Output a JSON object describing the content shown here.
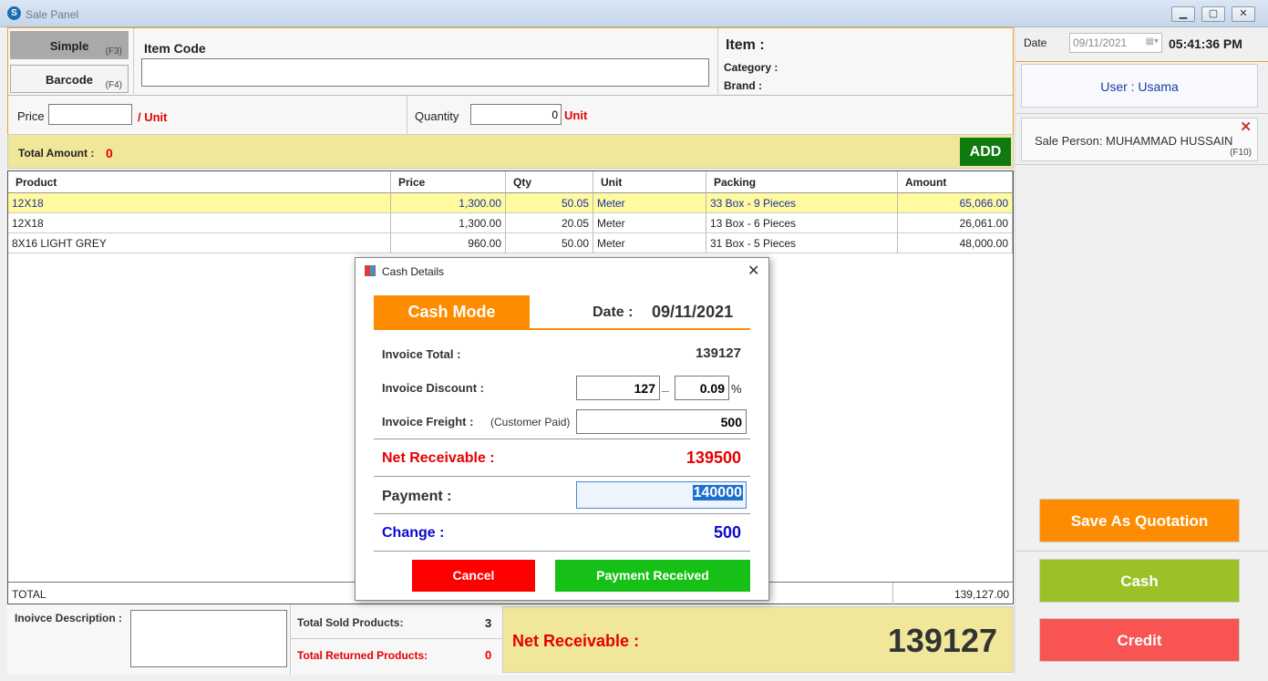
{
  "window": {
    "title": "Sale Panel",
    "app_icon": "S"
  },
  "mode": {
    "simple_label": "Simple",
    "simple_key": "(F3)",
    "barcode_label": "Barcode",
    "barcode_key": "(F4)"
  },
  "item_code": {
    "label": "Item Code",
    "value": ""
  },
  "item_info": {
    "item_label": "Item :",
    "category_label": "Category :",
    "brand_label": "Brand :"
  },
  "price": {
    "label": "Price",
    "value": "",
    "unit": "/ Unit"
  },
  "quantity": {
    "label": "Quantity",
    "value": "0",
    "unit": "Unit"
  },
  "total_amount": {
    "label": "Total Amount :",
    "value": "0"
  },
  "add_label": "ADD",
  "table": {
    "headers": [
      "Product",
      "Price",
      "Qty",
      "Unit",
      "Packing",
      "Amount"
    ],
    "rows": [
      {
        "product": "12X18",
        "price": "1,300.00",
        "qty": "50.05",
        "unit": "Meter",
        "packing": "33 Box - 9 Pieces",
        "amount": "65,066.00"
      },
      {
        "product": "12X18",
        "price": "1,300.00",
        "qty": "20.05",
        "unit": "Meter",
        "packing": "13 Box - 6 Pieces",
        "amount": "26,061.00"
      },
      {
        "product": "8X16 LIGHT GREY",
        "price": "960.00",
        "qty": "50.00",
        "unit": "Meter",
        "packing": "31 Box - 5 Pieces",
        "amount": "48,000.00"
      }
    ],
    "total_label": "TOTAL",
    "total_value": "139,127.00"
  },
  "sidebar": {
    "date_label": "Date",
    "date_value": "09/11/2021",
    "time": "05:41:36 PM",
    "user": "User : Usama",
    "sale_person": "Sale Person: MUHAMMAD HUSSAIN",
    "sale_person_key": "(F10)",
    "quotation_label": "Save As Quotation",
    "cash_label": "Cash",
    "credit_label": "Credit"
  },
  "bottom": {
    "description_label": "Inoivce Description :",
    "sold_label": "Total Sold Products:",
    "sold_value": "3",
    "returned_label": "Total Returned Products:",
    "returned_value": "0",
    "net_label": "Net Receivable :",
    "net_value": "139127"
  },
  "dialog": {
    "title": "Cash Details",
    "mode": "Cash Mode",
    "date_label": "Date :",
    "date_value": "09/11/2021",
    "invoice_total_label": "Invoice Total :",
    "invoice_total_value": "139127",
    "discount_label": "Invoice Discount :",
    "discount_amount": "127",
    "discount_sep": "_",
    "discount_percent": "0.09",
    "percent_sign": "%",
    "freight_label": "Invoice Freight :",
    "freight_note": "(Customer Paid)",
    "freight_value": "500",
    "net_label": "Net Receivable :",
    "net_value": "139500",
    "payment_label": "Payment :",
    "payment_value": "140000",
    "change_label": "Change :",
    "change_value": "500",
    "cancel_label": "Cancel",
    "received_label": "Payment Received"
  },
  "colors": {
    "accent_orange": "#ff8c00",
    "red": "#e60000",
    "blue": "#0a0ad0",
    "green": "#16c016",
    "olive": "#9ac227",
    "coral": "#f85454",
    "yellow_band": "#f0e79b"
  }
}
